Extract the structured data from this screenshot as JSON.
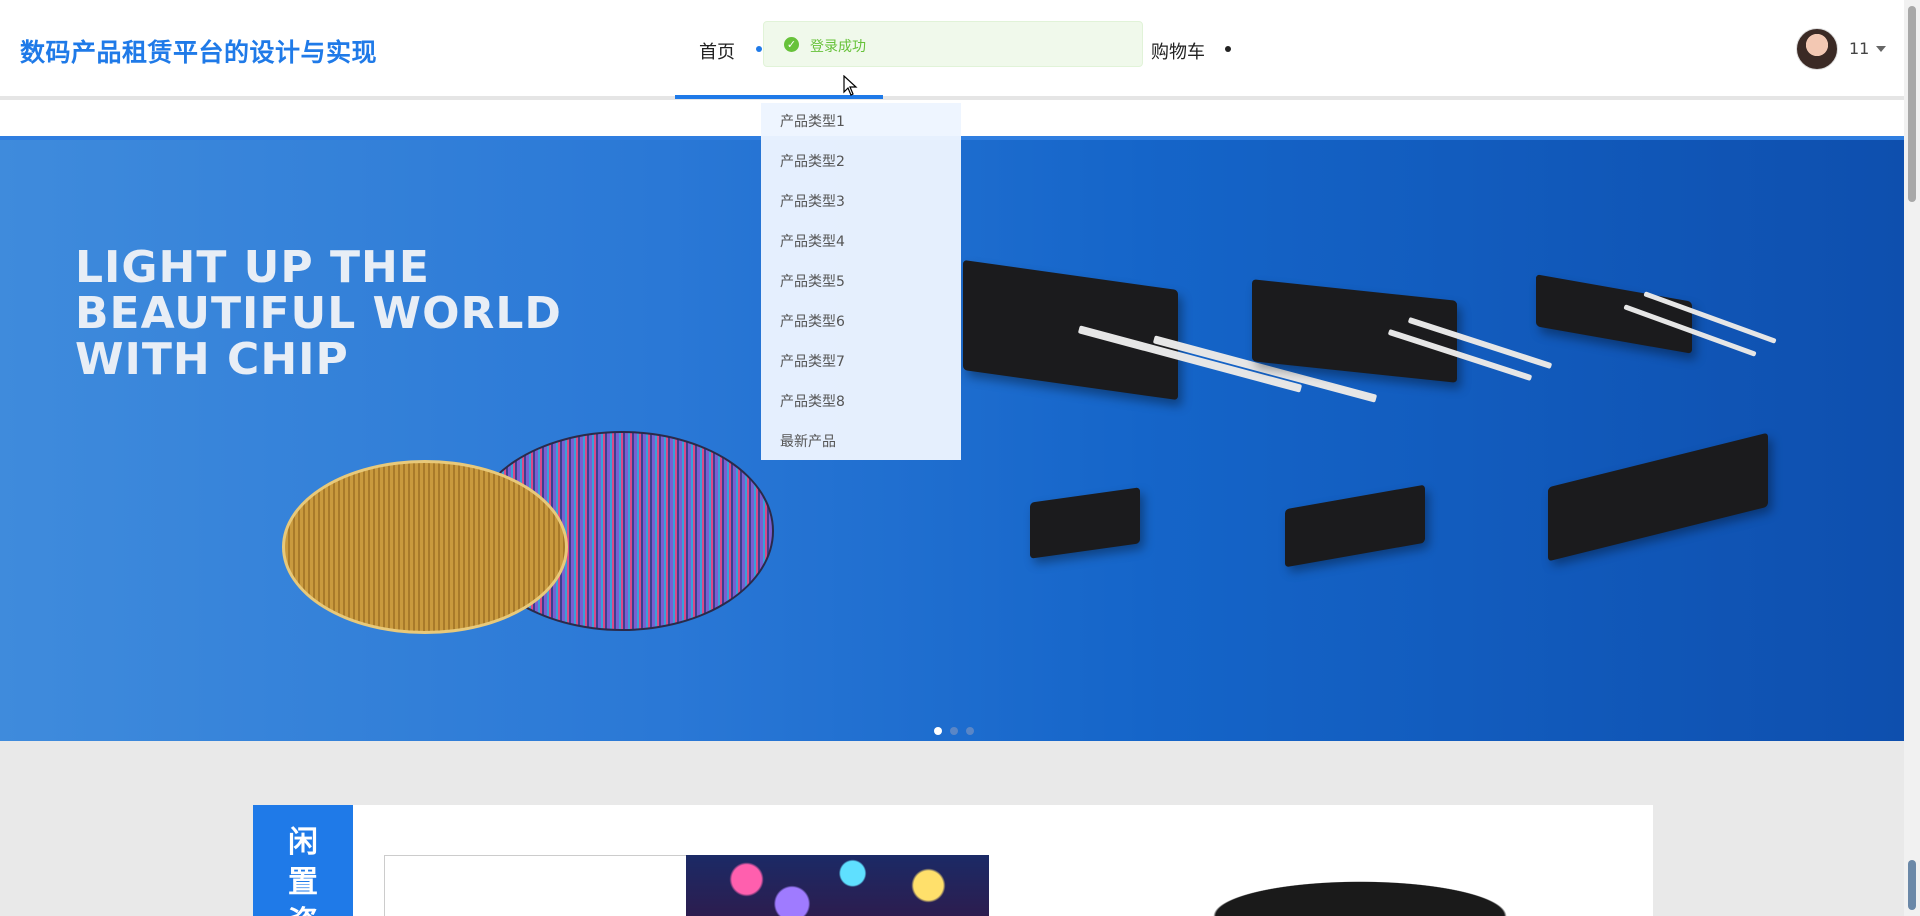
{
  "header": {
    "site_title": "数码产品租赁平台的设计与实现",
    "nav": {
      "home": "首页",
      "cart": "购物车"
    },
    "user": {
      "name": "11"
    }
  },
  "toast": {
    "message": "登录成功",
    "type": "success",
    "color": "#67c23a"
  },
  "dropdown": {
    "items": [
      "产品类型1",
      "产品类型2",
      "产品类型3",
      "产品类型4",
      "产品类型5",
      "产品类型6",
      "产品类型7",
      "产品类型8",
      "最新产品"
    ]
  },
  "banner": {
    "heading_lines": [
      "LIGHT UP THE",
      "BEAUTIFUL WORLD",
      "WITH CHIP"
    ],
    "slides_total": 3,
    "active_slide": 1
  },
  "section": {
    "tab_chars": [
      "闲",
      "置",
      "资"
    ]
  },
  "colors": {
    "brand": "#1f7ae8",
    "success": "#67c23a"
  }
}
